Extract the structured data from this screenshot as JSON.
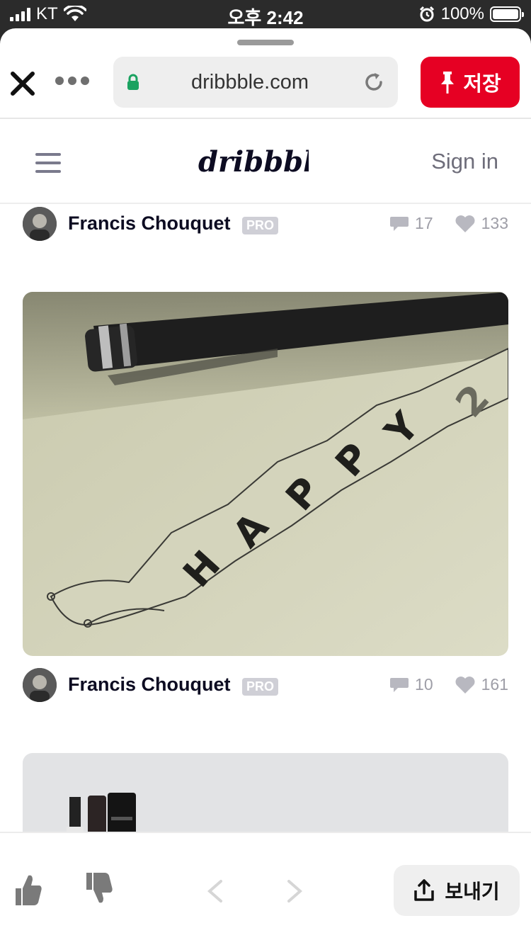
{
  "status_bar": {
    "carrier": "KT",
    "time": "오후 2:42",
    "battery": "100%",
    "signal_bars": 4,
    "battery_level": 1.0
  },
  "browser": {
    "url": "dribbble.com",
    "save_label": "저장",
    "icons": [
      "close-icon",
      "more-icon",
      "lock-icon",
      "reload-icon",
      "pin-icon"
    ]
  },
  "site_header": {
    "logo_text": "dribbble",
    "sign_in_label": "Sign in"
  },
  "shots": [
    {
      "author": "Francis Chouquet",
      "badge": "PRO",
      "comments": "17",
      "likes": "133"
    },
    {
      "author": "Francis Chouquet",
      "badge": "PRO",
      "comments": "10",
      "likes": "161",
      "image_text": "HAPPY 2"
    }
  ],
  "bottom_bar": {
    "send_label": "보내기",
    "icons": [
      "thumbs-up-icon",
      "thumbs-down-icon",
      "chevron-left-icon",
      "chevron-right-icon",
      "share-icon"
    ]
  },
  "colors": {
    "save_red": "#e60023",
    "dribbble_navy": "#0d0c22",
    "muted_gray": "#9e9ea7",
    "lock_green": "#1aa260"
  }
}
